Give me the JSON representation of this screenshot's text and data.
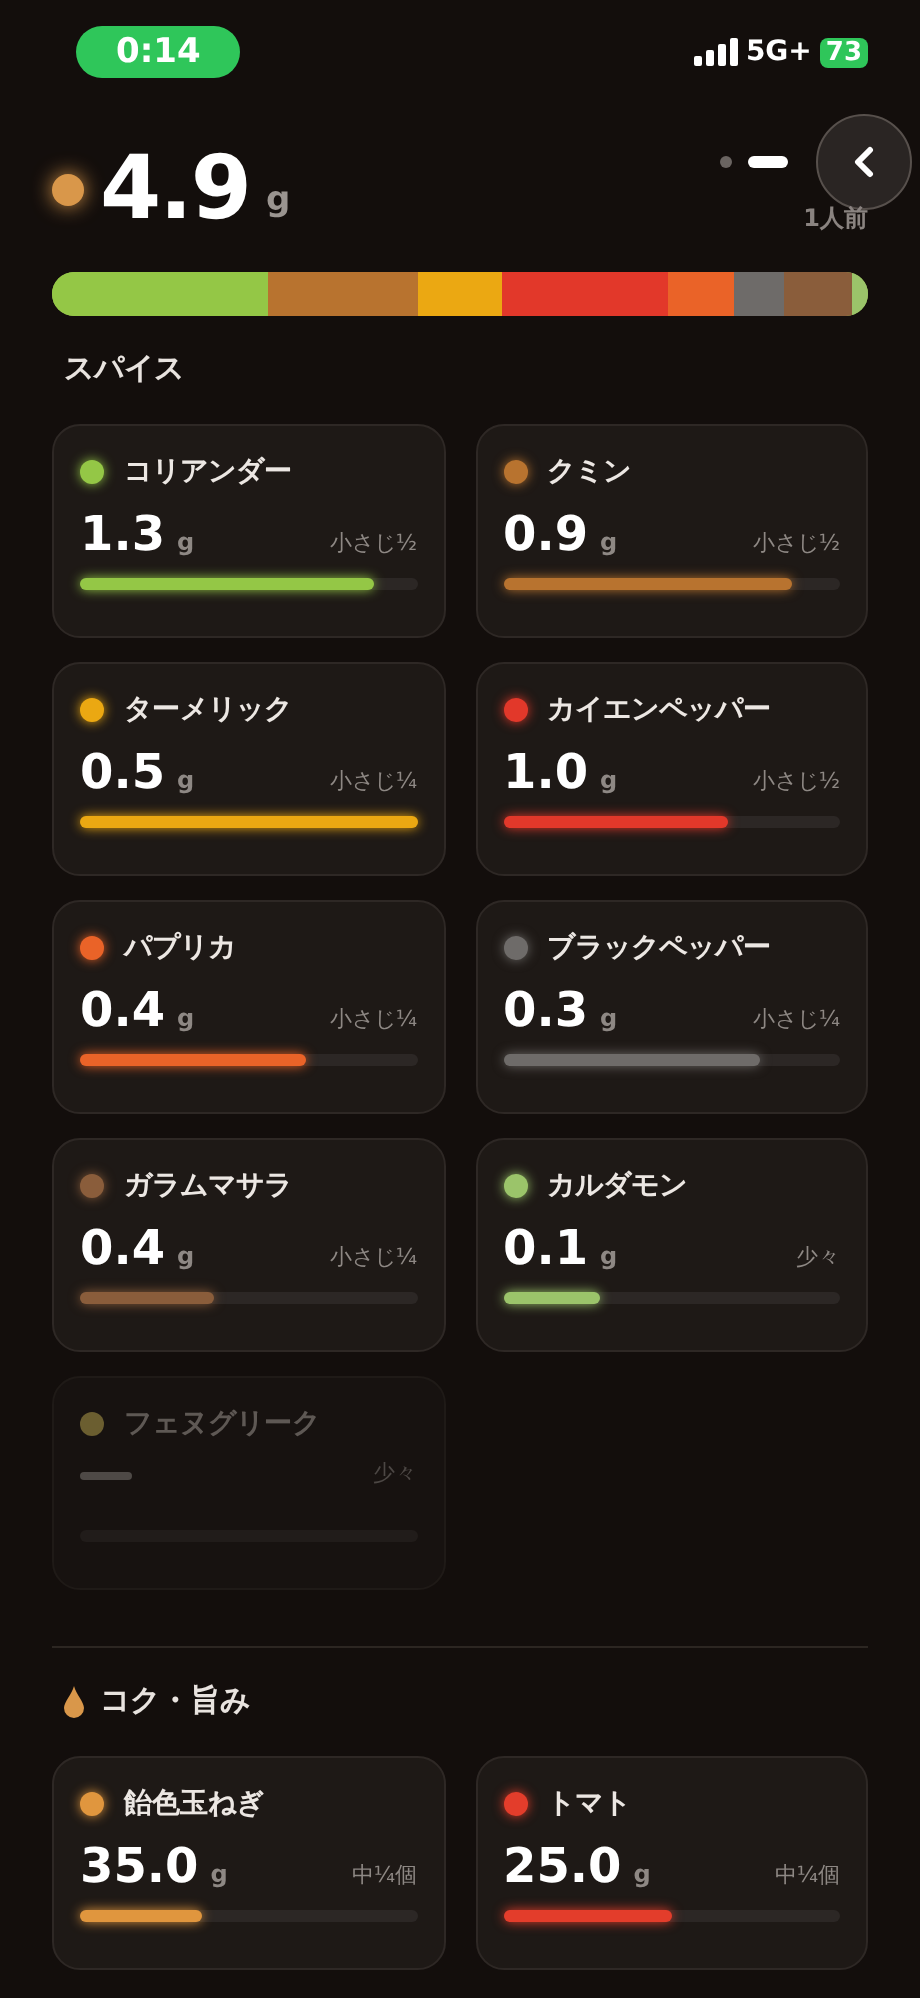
{
  "status_bar": {
    "time": "0:14",
    "network": "5G+",
    "battery": "73"
  },
  "pager": [
    {
      "selected": false
    },
    {
      "selected": true
    }
  ],
  "total": {
    "amount": "4.9",
    "unit": "g",
    "servings": "1人前",
    "color": "#d9974a"
  },
  "sections": [
    {
      "title": "スパイス",
      "kind": "plain",
      "items": [
        {
          "name": "コリアンダー",
          "amount": "1.3",
          "unit": "g",
          "measure": "小さじ½",
          "color": "#94c746",
          "level": 0.87,
          "disabled": false
        },
        {
          "name": "クミン",
          "amount": "0.9",
          "unit": "g",
          "measure": "小さじ½",
          "color": "#b8732f",
          "level": 0.86,
          "disabled": false
        },
        {
          "name": "ターメリック",
          "amount": "0.5",
          "unit": "g",
          "measure": "小さじ¼",
          "color": "#eba812",
          "level": 1.0,
          "disabled": false
        },
        {
          "name": "カイエンペッパー",
          "amount": "1.0",
          "unit": "g",
          "measure": "小さじ½",
          "color": "#e2382a",
          "level": 0.67,
          "disabled": false
        },
        {
          "name": "パプリカ",
          "amount": "0.4",
          "unit": "g",
          "measure": "小さじ¼",
          "color": "#ea6328",
          "level": 0.67,
          "disabled": false
        },
        {
          "name": "ブラックペッパー",
          "amount": "0.3",
          "unit": "g",
          "measure": "小さじ¼",
          "color": "#6e6b69",
          "level": 0.76,
          "disabled": false
        },
        {
          "name": "ガラムマサラ",
          "amount": "0.4",
          "unit": "g",
          "measure": "小さじ¼",
          "color": "#8a5d3b",
          "level": 0.4,
          "disabled": false
        },
        {
          "name": "カルダモン",
          "amount": "0.1",
          "unit": "g",
          "measure": "少々",
          "color": "#9bc46a",
          "level": 0.29,
          "disabled": false
        },
        {
          "name": "フェヌグリーク",
          "measure": "少々",
          "color": "#6b5e30",
          "disabled": true
        }
      ]
    },
    {
      "title": "コク・旨み",
      "kind": "drop",
      "items": [
        {
          "name": "飴色玉ねぎ",
          "amount": "35.0",
          "unit": "g",
          "measure": "中¼個",
          "color": "#e0963e",
          "level": 0.36,
          "disabled": false
        },
        {
          "name": "トマト",
          "amount": "25.0",
          "unit": "g",
          "measure": "中¼個",
          "color": "#e33d2b",
          "level": 0.5,
          "disabled": false
        }
      ]
    }
  ]
}
